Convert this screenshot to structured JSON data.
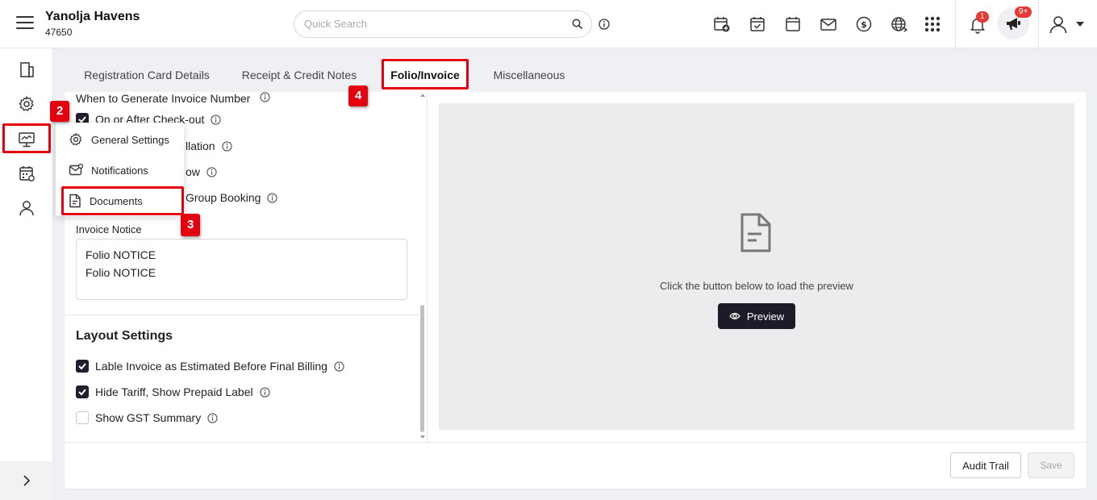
{
  "header": {
    "hotel_name": "Yanolja Havens",
    "hotel_id": "47650",
    "search_placeholder": "Quick Search",
    "notification_count": "1",
    "announcement_count": "9+"
  },
  "tabs": [
    {
      "label": "Registration Card Details"
    },
    {
      "label": "Receipt & Credit Notes"
    },
    {
      "label": "Folio/Invoice",
      "active": true
    },
    {
      "label": "Miscellaneous"
    }
  ],
  "invoice_settings": {
    "when_label": "When to Generate Invoice Number",
    "options": [
      {
        "label": "On or After Check-out",
        "checked": true
      },
      {
        "label": "llation"
      },
      {
        "label": "ow"
      },
      {
        "label": "Group Booking"
      }
    ],
    "notice_label": "Invoice Notice",
    "notice_value": "Folio NOTICE\nFolio NOTICE"
  },
  "layout_settings": {
    "title": "Layout Settings",
    "options": [
      {
        "label": "Lable Invoice as Estimated Before Final Billing",
        "checked": true
      },
      {
        "label": "Hide Tariff, Show Prepaid Label",
        "checked": true
      },
      {
        "label": "Show GST Summary",
        "checked": false
      }
    ]
  },
  "preview": {
    "message": "Click the button below to load the preview",
    "button_label": "Preview"
  },
  "footer": {
    "audit_label": "Audit Trail",
    "save_label": "Save"
  },
  "dropdown": {
    "items": [
      {
        "label": "General Settings",
        "icon": "gear-icon"
      },
      {
        "label": "Notifications",
        "icon": "mail-icon"
      },
      {
        "label": "Documents",
        "icon": "document-icon"
      }
    ]
  },
  "annotations": {
    "step2": "2",
    "step3": "3",
    "step4": "4"
  },
  "colors": {
    "annotation_red": "#e3000f",
    "primary_dark": "#1b1b2a",
    "badge_red": "#e53935"
  }
}
